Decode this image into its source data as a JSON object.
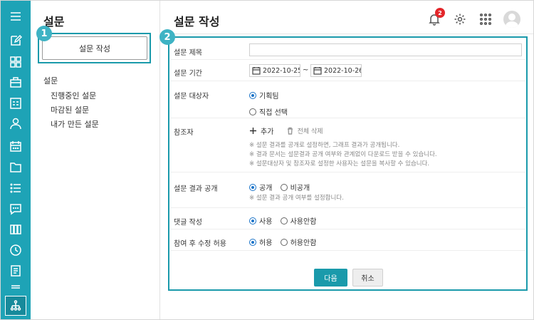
{
  "side": {
    "title": "설문",
    "new_button": "설문 작성",
    "group_label": "설문",
    "items": [
      "진행중인 설문",
      "마감된 설문",
      "내가 만든 설문"
    ]
  },
  "callouts": {
    "one": "1",
    "two": "2"
  },
  "header": {
    "title": "설문 작성",
    "notification_count": "2"
  },
  "rail_icons": [
    "menu-icon",
    "edit-icon",
    "grid-icon",
    "bag-icon",
    "contact-card-icon",
    "person-icon",
    "calendar-icon",
    "folder-icon",
    "list-icon",
    "chat-icon",
    "boards-icon",
    "clock-icon",
    "note-icon",
    "minus-icon",
    "org-chart-icon"
  ],
  "form": {
    "title_label": "설문 제목",
    "title_value": "",
    "period_label": "설문 기간",
    "start_date": "2022-10-25",
    "end_date": "2022-10-26",
    "date_separator": "~",
    "target_label": "설문 대상자",
    "target_options": [
      "기획팀",
      "직접 선택"
    ],
    "target_selected": "기획팀",
    "ref_label": "참조자",
    "ref_add": "추가",
    "ref_delete_all": "전체 삭제",
    "ref_notes": [
      "※ 설문 결과를 공개로 설정하면, 그래프 결과가 공개됩니다.",
      "※ 결과 문서는 설문결과 공개 여부와 관계없이 다운로드 받을 수 있습니다.",
      "※ 설문대상자 및 참조자로 설정한 사용자는 설문을 복사할 수 있습니다."
    ],
    "public_label": "설문 결과 공개",
    "public_options": [
      "공개",
      "비공개"
    ],
    "public_selected": "공개",
    "public_note": "※ 설문 결과 공개 여부를 설정합니다.",
    "comment_label": "댓글 작성",
    "comment_options": [
      "사용",
      "사용안함"
    ],
    "comment_selected": "사용",
    "edit_label": "참여 후 수정 허용",
    "edit_options": [
      "허용",
      "허용안함"
    ],
    "edit_selected": "허용",
    "next_button": "다음",
    "cancel_button": "취소"
  },
  "colors": {
    "accent": "#1ea3b6",
    "highlight": "#1a9aab",
    "radio": "#1a73c8",
    "badge_red": "#e3262a"
  }
}
